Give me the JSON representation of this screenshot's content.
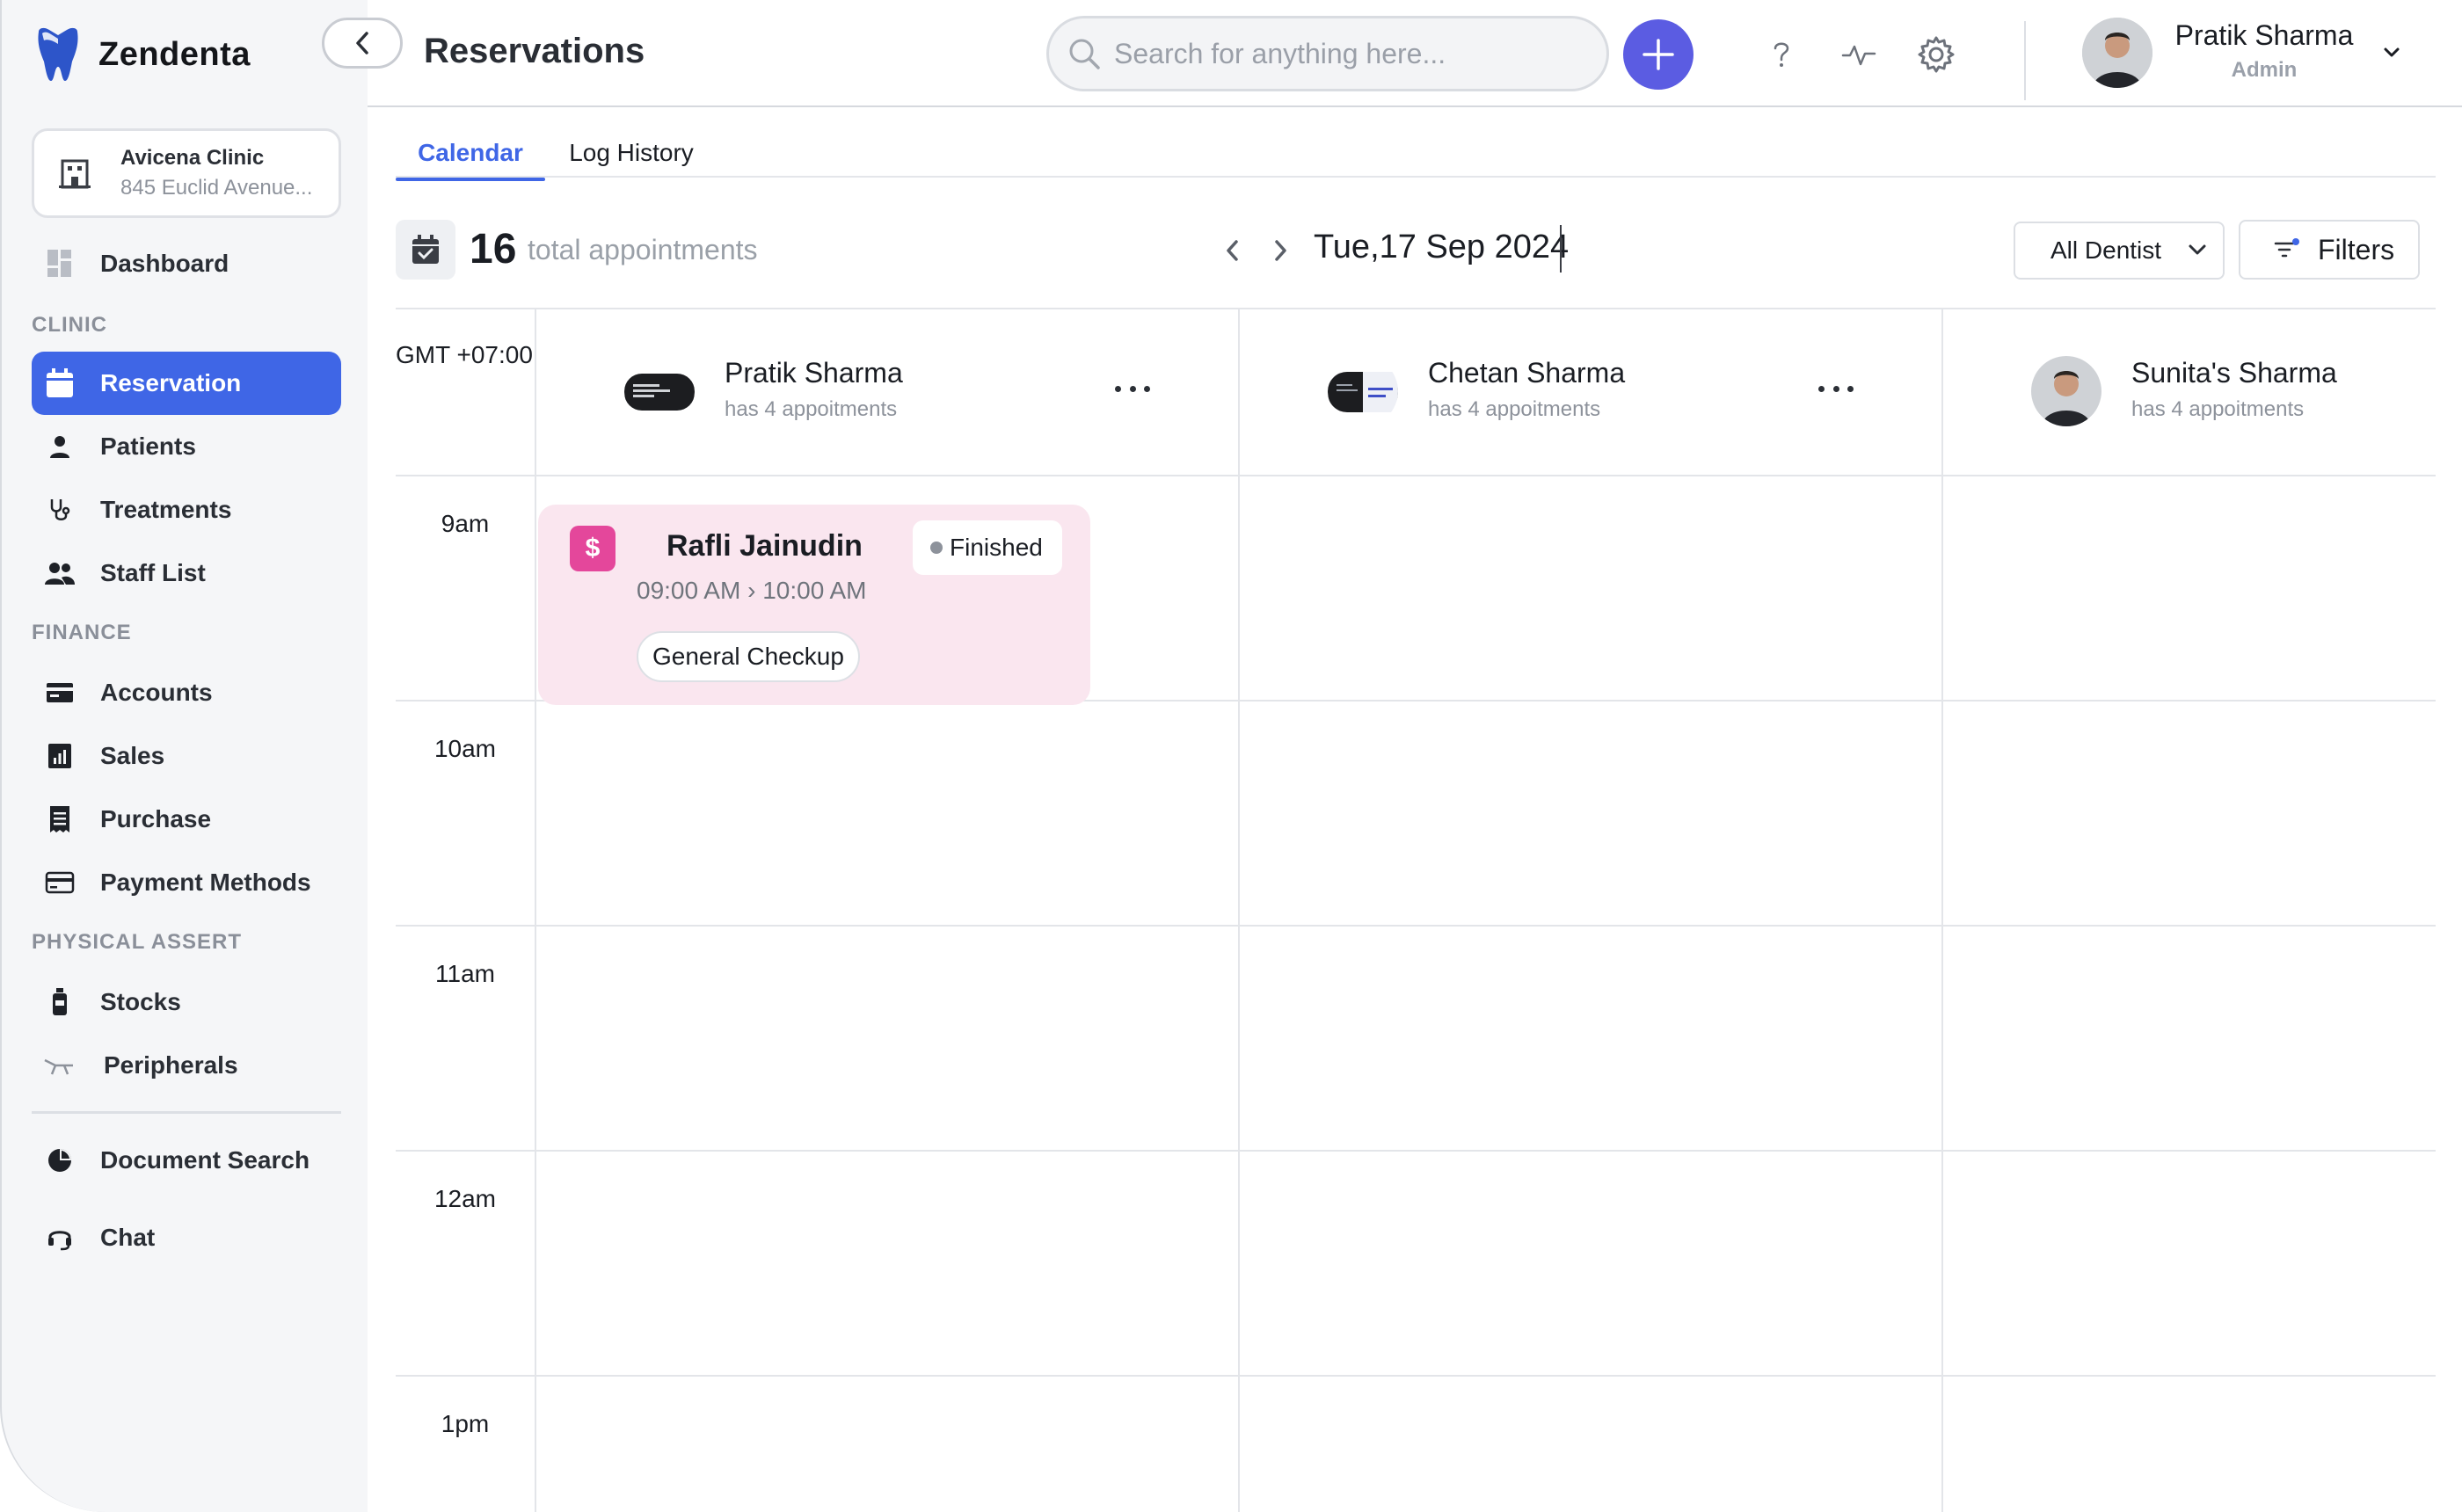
{
  "app": {
    "name": "Zendenta",
    "page_title": "Reservations"
  },
  "clinic": {
    "name": "Avicena Clinic",
    "address": "845 Euclid Avenue..."
  },
  "sidebar": {
    "dashboard": {
      "label": "Dashboard",
      "icon": "dashboard-icon"
    },
    "sections": {
      "clinic": "CLINIC",
      "finance": "FINANCE",
      "physical": "PHYSICAL ASSERT"
    },
    "items": [
      {
        "label": "Reservation",
        "icon": "calendar-icon",
        "active": true
      },
      {
        "label": "Patients",
        "icon": "person-icon"
      },
      {
        "label": "Treatments",
        "icon": "stethoscope-icon"
      },
      {
        "label": "Staff List",
        "icon": "group-icon"
      },
      {
        "label": "Accounts",
        "icon": "card-icon"
      },
      {
        "label": "Sales",
        "icon": "chart-icon"
      },
      {
        "label": "Purchase",
        "icon": "receipt-icon"
      },
      {
        "label": "Payment Methods",
        "icon": "credit-card-icon"
      },
      {
        "label": "Stocks",
        "icon": "bottle-icon"
      },
      {
        "label": "Peripherals",
        "icon": "dental-chair-icon"
      },
      {
        "label": "Document Search",
        "icon": "pie-icon"
      },
      {
        "label": "Chat",
        "icon": "headset-icon"
      }
    ]
  },
  "header": {
    "search_placeholder": "Search for anything here...",
    "user": {
      "name": "Pratik Sharma",
      "role": "Admin"
    }
  },
  "tabs": [
    {
      "label": "Calendar",
      "active": true
    },
    {
      "label": "Log History",
      "active": false
    }
  ],
  "toolbar": {
    "count": "16",
    "count_label": "total appointments",
    "date": "Tue,17 Sep 2024",
    "dentist_filter": "All Dentist",
    "filters_label": "Filters"
  },
  "calendar": {
    "timezone": "GMT +07:00",
    "times": [
      "9am",
      "10am",
      "11am",
      "12am",
      "1pm"
    ],
    "dentists": [
      {
        "name": "Pratik Sharma",
        "sub": "has 4 appoitments"
      },
      {
        "name": "Chetan Sharma",
        "sub": "has 4 appoitments"
      },
      {
        "name": "Sunita's Sharma",
        "sub": "has 4 appoitments"
      }
    ],
    "appointment": {
      "patient": "Rafli Jainudin",
      "status": "Finished",
      "start": "09:00 AM",
      "end": "10:00 AM",
      "type": "General Checkup"
    }
  },
  "colors": {
    "accent": "#3f66e6",
    "add_button": "#5b5ce2",
    "appointment_bg": "#fae6ef",
    "appointment_icon": "#e4479b"
  }
}
